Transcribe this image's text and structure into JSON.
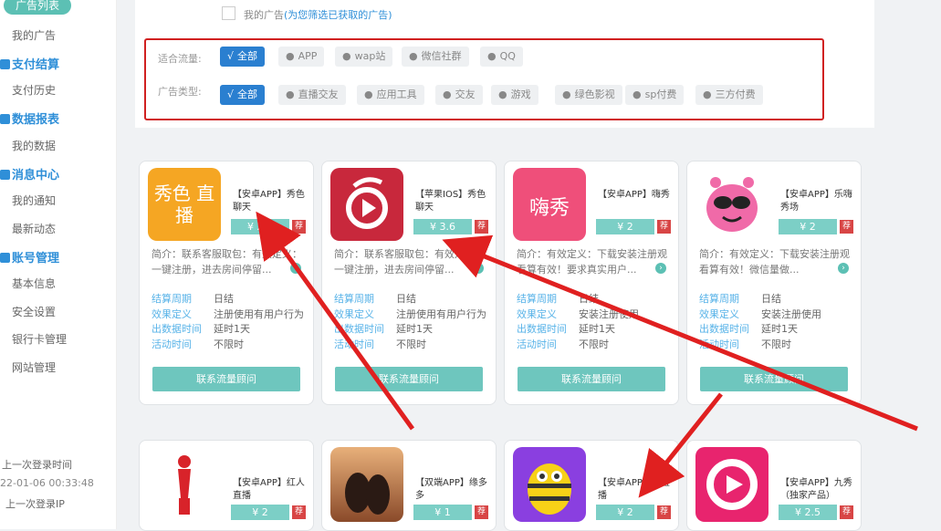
{
  "sidebar": {
    "top_pill": "广告列表",
    "items": {
      "my_ads": "我的广告",
      "pay_head": "支付结算",
      "pay_history": "支付历史",
      "data_head": "数据报表",
      "my_data": "我的数据",
      "msg_head": "消息中心",
      "my_notice": "我的通知",
      "latest": "最新动态",
      "acct_head": "账号管理",
      "basic": "基本信息",
      "security": "安全设置",
      "bank": "银行卡管理",
      "site": "网站管理"
    },
    "footer": {
      "last_login_label": "上一次登录时间",
      "last_login_time": "22-01-06 00:33:48",
      "last_ip_label": "上一次登录IP"
    }
  },
  "filter": {
    "checkbox_label": "我的广告",
    "checkbox_hint": "(为您筛选已获取的广告)",
    "traffic_label": "适合流量:",
    "traffic": [
      "全部",
      "APP",
      "wap站",
      "微信社群",
      "QQ"
    ],
    "type_label": "广告类型:",
    "types": [
      "全部",
      "直播交友",
      "应用工具",
      "交友",
      "游戏",
      "绿色影视",
      "sp付费",
      "三方付费"
    ],
    "check_mark": "√",
    "dot": "●"
  },
  "cards": [
    {
      "name": "【安卓APP】秀色聊天",
      "price": "¥ 2.2",
      "badge": "荐",
      "intro": "简介：联系客服取包：有效定义：一键注册，进去房间停留...",
      "icon_text": "秀色 直播",
      "fields": [
        [
          "结算周期",
          "日结"
        ],
        [
          "效果定义",
          "注册使用有用户行为"
        ],
        [
          "出数据时间",
          "延时1天"
        ],
        [
          "活动时间",
          "不限时"
        ]
      ],
      "button": "联系流量顾问"
    },
    {
      "name": "【苹果IOS】秀色聊天",
      "price": "¥ 3.6",
      "badge": "荐",
      "intro": "简介：联系客服取包：有效定义：一键注册，进去房间停留...",
      "icon_text": "",
      "fields": [
        [
          "结算周期",
          "日结"
        ],
        [
          "效果定义",
          "注册使用有用户行为"
        ],
        [
          "出数据时间",
          "延时1天"
        ],
        [
          "活动时间",
          "不限时"
        ]
      ],
      "button": "联系流量顾问"
    },
    {
      "name": "【安卓APP】嗨秀",
      "price": "¥ 2",
      "badge": "荐",
      "intro": "简介：有效定义：下载安装注册观看算有效！要求真实用户...",
      "icon_text": "嗨秀",
      "fields": [
        [
          "结算周期",
          "日结"
        ],
        [
          "效果定义",
          "安装注册使用"
        ],
        [
          "出数据时间",
          "延时1天"
        ],
        [
          "活动时间",
          "不限时"
        ]
      ],
      "button": "联系流量顾问"
    },
    {
      "name": "【安卓APP】乐嗨秀场",
      "price": "¥ 2",
      "badge": "荐",
      "intro": "简介：有效定义：下载安装注册观看算有效！微信量做...",
      "icon_text": "",
      "fields": [
        [
          "结算周期",
          "日结"
        ],
        [
          "效果定义",
          "安装注册使用"
        ],
        [
          "出数据时间",
          "延时1天"
        ],
        [
          "活动时间",
          "不限时"
        ]
      ],
      "button": "联系流量顾问"
    }
  ],
  "cards_row2": [
    {
      "name": "【安卓APP】红人直播",
      "price": "¥ 2",
      "badge": "荐"
    },
    {
      "name": "【双端APP】缘多多",
      "price": "¥ 1",
      "badge": "荐"
    },
    {
      "name": "【安卓APP】疯直播",
      "price": "¥ 2",
      "badge": "荐"
    },
    {
      "name": "【安卓APP】九秀（独家产品）",
      "price": "¥ 2.5",
      "badge": "荐"
    }
  ],
  "colors": {
    "accent_teal": "#5cc0b4",
    "accent_blue": "#2a7fd0",
    "highlight_red": "#d02020"
  }
}
